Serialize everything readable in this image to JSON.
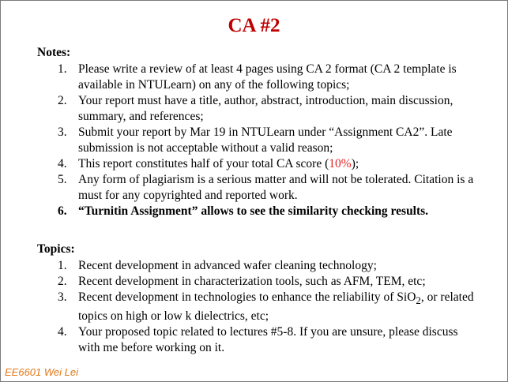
{
  "title": "CA #2",
  "notes": {
    "heading": "Notes:",
    "items": [
      {
        "num": "1.",
        "text": "Please write a review of at least 4 pages using CA 2 format (CA 2 template is available in NTULearn) on any of the following topics;"
      },
      {
        "num": "2.",
        "text": "Your report must have a title, author, abstract, introduction, main discussion, summary, and references;"
      },
      {
        "num": "3.",
        "text": "Submit your report by Mar 19 in NTULearn under “Assignment CA2”. Late submission is not acceptable without a valid reason;"
      },
      {
        "num": "4.",
        "text_before": "This report constitutes half of your total CA score (",
        "highlight": "10%",
        "text_after": ");"
      },
      {
        "num": "5.",
        "text": "Any form of plagiarism is a serious matter and will not be tolerated. Citation is a must for any copyrighted and reported work."
      },
      {
        "num": "6.",
        "text": "“Turnitin Assignment” allows to see the similarity checking results."
      }
    ]
  },
  "topics": {
    "heading": "Topics:",
    "items": [
      {
        "num": "1.",
        "text": "Recent development in advanced wafer cleaning technology;"
      },
      {
        "num": "2.",
        "text": "Recent development in characterization tools, such as AFM, TEM, etc;"
      },
      {
        "num": "3.",
        "text_before": "Recent development in technologies to enhance the reliability of SiO",
        "subscript": "2",
        "text_after": ", or related topics on high or low k dielectrics, etc;"
      },
      {
        "num": "4.",
        "text": "Your proposed topic related to lectures #5-8. If you are unsure, please discuss with me before working on it."
      }
    ]
  },
  "footer": "EE6601 Wei Lei",
  "colors": {
    "title": "#c00000",
    "highlight": "#e02020",
    "footer": "#e07818",
    "border": "#7a7a7a"
  }
}
